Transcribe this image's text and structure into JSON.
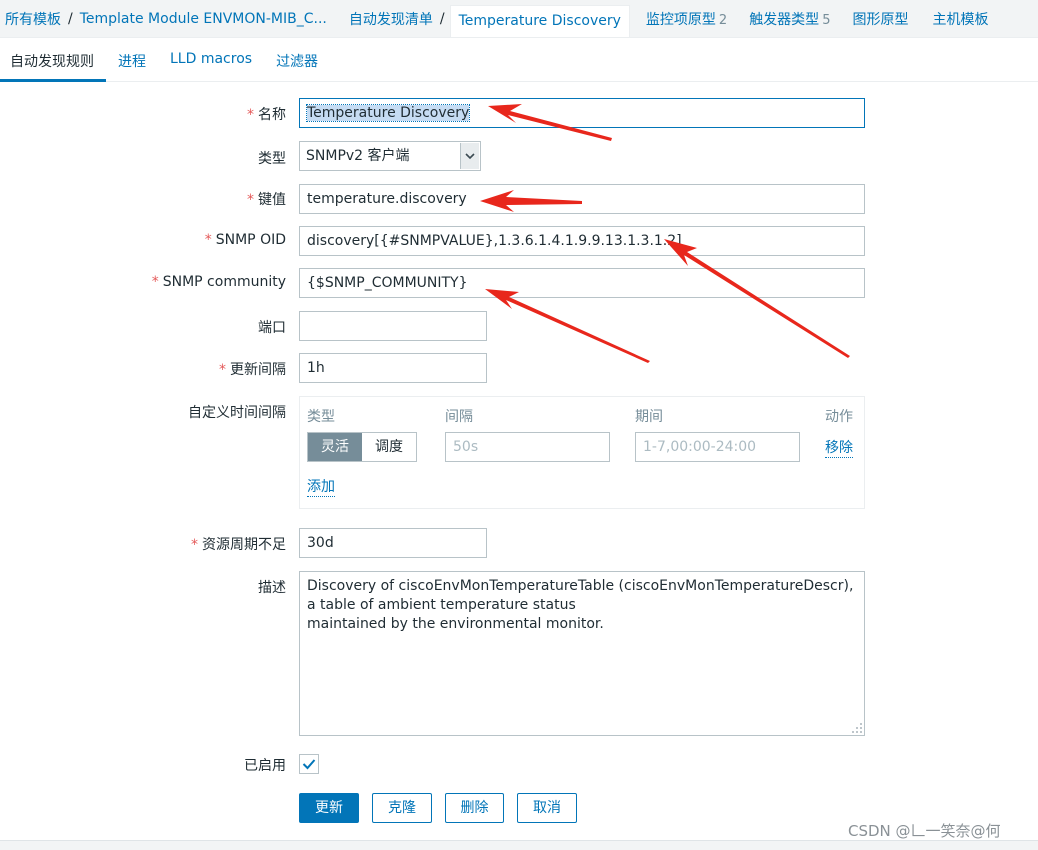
{
  "breadcrumb": {
    "items": [
      {
        "label": "所有模板"
      },
      {
        "label": "Template Module ENVMON-MIB_C..."
      },
      {
        "label": "自动发现清单"
      },
      {
        "label": "Temperature Discovery"
      }
    ],
    "separator": "/",
    "nav": [
      {
        "label": "监控项原型",
        "count": "2"
      },
      {
        "label": "触发器类型",
        "count": "5"
      },
      {
        "label": "图形原型",
        "count": ""
      },
      {
        "label": "主机模板",
        "count": ""
      }
    ]
  },
  "tabs": [
    {
      "label": "自动发现规则",
      "active": true
    },
    {
      "label": "进程",
      "active": false
    },
    {
      "label": "LLD macros",
      "active": false
    },
    {
      "label": "过滤器",
      "active": false
    }
  ],
  "form": {
    "name": {
      "label": "名称",
      "required": true,
      "value": "Temperature Discovery"
    },
    "type": {
      "label": "类型",
      "value": "SNMPv2 客户端"
    },
    "key": {
      "label": "键值",
      "required": true,
      "value": "temperature.discovery"
    },
    "snmp_oid": {
      "label": "SNMP OID",
      "required": true,
      "value": "discovery[{#SNMPVALUE},1.3.6.1.4.1.9.9.13.1.3.1.2]"
    },
    "snmp_community": {
      "label": "SNMP community",
      "required": true,
      "value": "{$SNMP_COMMUNITY}"
    },
    "port": {
      "label": "端口",
      "value": ""
    },
    "update_interval": {
      "label": "更新间隔",
      "required": true,
      "value": "1h"
    },
    "custom_intervals": {
      "label": "自定义时间间隔",
      "headers": {
        "type": "类型",
        "interval": "间隔",
        "period": "期间",
        "action": "动作"
      },
      "rows": [
        {
          "type_options": [
            "灵活",
            "调度"
          ],
          "type_selected": "灵活",
          "interval_placeholder": "50s",
          "period_placeholder": "1-7,00:00-24:00",
          "remove": "移除"
        }
      ],
      "add": "添加"
    },
    "lifetime": {
      "label": "资源周期不足",
      "required": true,
      "value": "30d"
    },
    "description": {
      "label": "描述",
      "value": "Discovery of ciscoEnvMonTemperatureTable (ciscoEnvMonTemperatureDescr), a table of ambient temperature status\nmaintained by the environmental monitor."
    },
    "enabled": {
      "label": "已启用",
      "checked": true
    }
  },
  "buttons": {
    "update": "更新",
    "clone": "克隆",
    "delete": "删除",
    "cancel": "取消"
  },
  "required_marker": "*",
  "watermark": "CSDN @𠃊一笑奈@何",
  "colors": {
    "link": "#0275b8",
    "required": "#e45959",
    "annotation_arrow": "#e8271c"
  }
}
